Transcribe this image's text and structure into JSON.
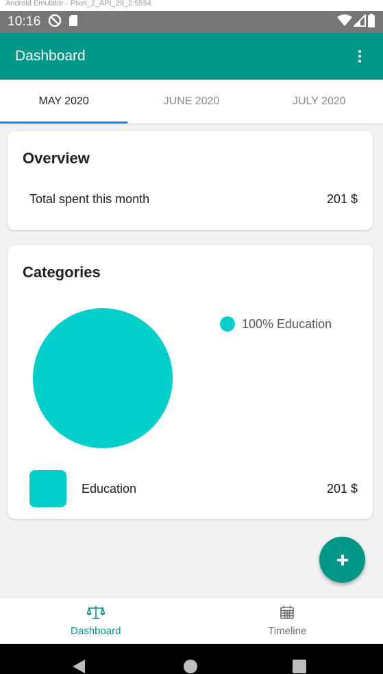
{
  "emulator": {
    "title": "Android Emulator - Pixel_2_API_29_2:5554"
  },
  "status_bar": {
    "time": "10:16"
  },
  "app_bar": {
    "title": "Dashboard"
  },
  "tabs": [
    {
      "label": "MAY 2020",
      "active": true
    },
    {
      "label": "JUNE 2020",
      "active": false
    },
    {
      "label": "JULY 2020",
      "active": false
    }
  ],
  "overview": {
    "title": "Overview",
    "total_label": "Total spent this month",
    "total_amount": "201 $"
  },
  "categories": {
    "title": "Categories",
    "legend_label": "100% Education",
    "items": [
      {
        "name": "Education",
        "amount": "201 $"
      }
    ]
  },
  "chart_data": {
    "type": "pie",
    "slices": [
      {
        "label": "Education",
        "value": 100,
        "color": "#00cec9"
      }
    ]
  },
  "bottom_nav": {
    "items": [
      {
        "label": "Dashboard",
        "icon": "scale-icon",
        "active": true
      },
      {
        "label": "Timeline",
        "icon": "calendar-icon",
        "active": false
      }
    ]
  },
  "colors": {
    "primary": "#009688",
    "tab_indicator": "#1e88e5",
    "category": "#00cec9"
  }
}
